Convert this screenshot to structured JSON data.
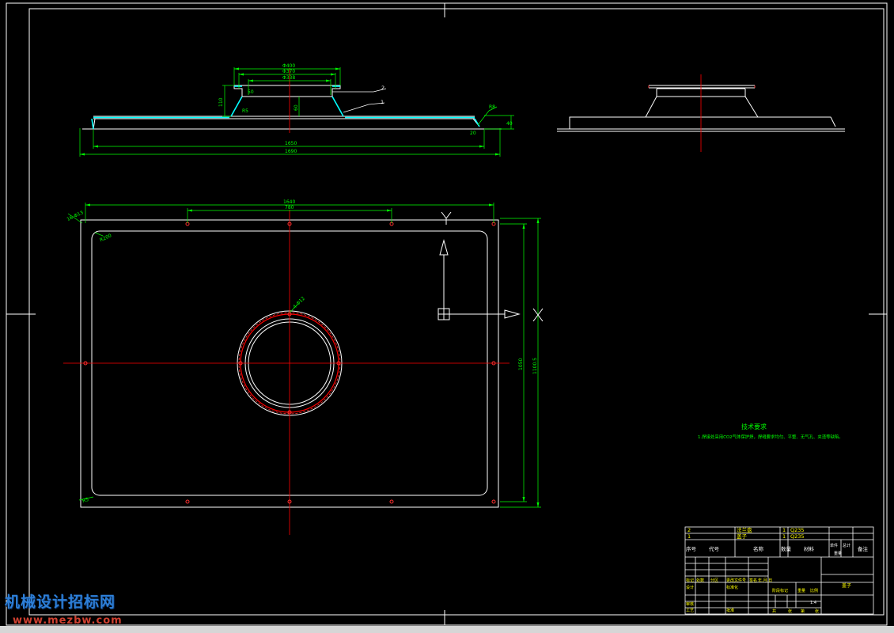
{
  "colors": {
    "background": "#000000",
    "outline": "#ffffff",
    "dimension": "#00ff00",
    "centerline": "#ff0000",
    "accent_cyan": "#00ffff",
    "title_text": "#ffff00"
  },
  "front_view": {
    "dims": {
      "d_top": "Φ400",
      "d_mid": "Φ370",
      "d_inner": "Φ338",
      "h_flange": "110",
      "h_center": "60",
      "h_small": "50",
      "r_small": "R5",
      "w_inner": "1650",
      "w_outer": "1690",
      "r_right": "R8",
      "edge_right": "40",
      "edge_h": "20"
    },
    "leaders": [
      "2",
      "1"
    ]
  },
  "plan_view": {
    "dims": {
      "top_total": "1640",
      "top_inner": "780",
      "side_inner": "1050",
      "side_outer": "1100.5",
      "hole_note": "16-Φ13",
      "corner_r": "R200",
      "ring_note": "4-Φ12",
      "corner_bl": "R5"
    },
    "axis_labels": {
      "x": "X",
      "y": "Y"
    }
  },
  "tech": {
    "title": "技术要求",
    "note": "1.焊接处采用CO2气体保护焊，焊缝要求均匀、平整、无气孔、夹渣等缺陷。"
  },
  "title_block": {
    "parts": [
      {
        "no": "2",
        "name": "法兰盘",
        "qty": "1",
        "material": "Q235"
      },
      {
        "no": "1",
        "name": "盖子",
        "qty": "1",
        "material": "Q235"
      }
    ],
    "headers": [
      "序号",
      "代号",
      "名称",
      "数量",
      "材料",
      "单件",
      "总计",
      "备注"
    ],
    "weight_label": "重量",
    "sign_labels": [
      "标记",
      "处数",
      "分区",
      "更改文件号",
      "签名",
      "年.月.日"
    ],
    "design_labels": [
      "设计",
      "标准化",
      "审核",
      "工艺",
      "批准"
    ],
    "stage_label": "阶段标记",
    "mass_label": "重量",
    "scale_label": "比例",
    "scale": "1:4",
    "sheet_labels": [
      "共",
      "张",
      "第",
      "张"
    ],
    "drawing_name": "盖子"
  },
  "watermark": {
    "title": "机械设计招标网",
    "url": "www.mezbw.com"
  }
}
